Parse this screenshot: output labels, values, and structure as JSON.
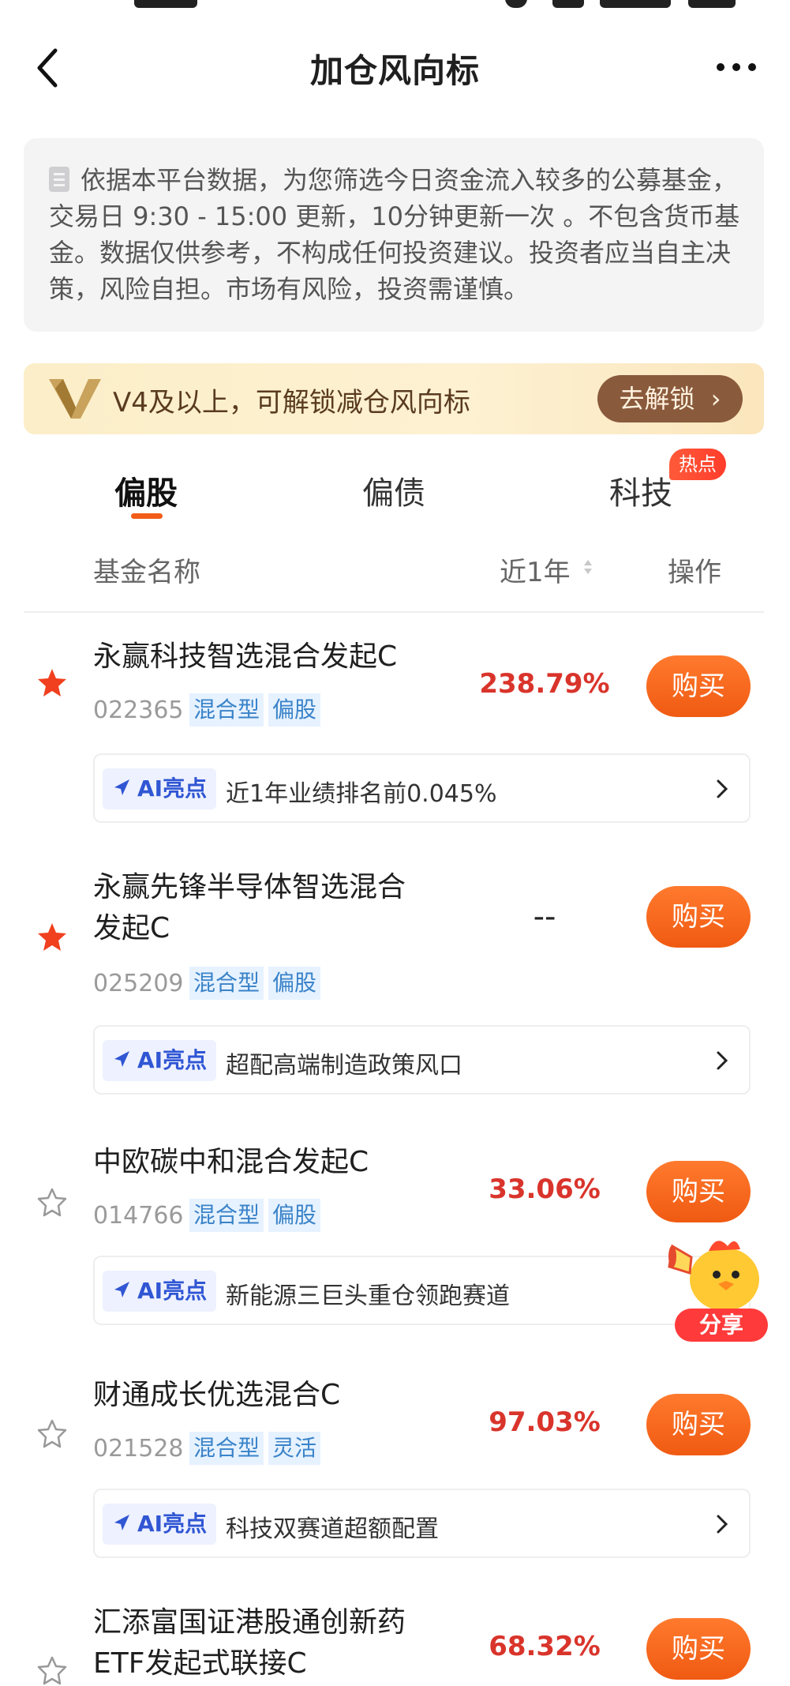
{
  "header": {
    "title": "加仓风向标"
  },
  "notice": {
    "text": "依据本平台数据，为您筛选今日资金流入较多的公募基金，交易日 9:30 - 15:00 更新，10分钟更新一次 。不包含货币基金。数据仅供参考，不构成任何投资建议。投资者应当自主决策，风险自担。市场有风险，投资需谨慎。"
  },
  "vip_banner": {
    "text": "V4及以上，可解锁减仓风向标",
    "button": "去解锁"
  },
  "tabs": [
    {
      "label": "偏股"
    },
    {
      "label": "偏债"
    },
    {
      "label": "科技",
      "badge": "热点"
    }
  ],
  "table_header": {
    "name": "基金名称",
    "period": "近1年",
    "action": "操作"
  },
  "funds": [
    {
      "name": "永赢科技智选混合发起C",
      "code": "022365",
      "tags": [
        "混合型",
        "偏股"
      ],
      "return": "238.79%",
      "buy": "购买",
      "ai_label": "AI亮点",
      "ai_text": "近1年业绩排名前0.045%",
      "starred": true
    },
    {
      "name_line1": "永赢先锋半导体智选混合",
      "name_line2": "发起C",
      "code": "025209",
      "tags": [
        "混合型",
        "偏股"
      ],
      "return": "--",
      "buy": "购买",
      "ai_label": "AI亮点",
      "ai_text": "超配高端制造政策风口",
      "starred": true
    },
    {
      "name": "中欧碳中和混合发起C",
      "code": "014766",
      "tags": [
        "混合型",
        "偏股"
      ],
      "return": "33.06%",
      "buy": "购买",
      "ai_label": "AI亮点",
      "ai_text": "新能源三巨头重仓领跑赛道",
      "starred": false
    },
    {
      "name": "财通成长优选混合C",
      "code": "021528",
      "tags": [
        "混合型",
        "灵活"
      ],
      "return": "97.03%",
      "buy": "购买",
      "ai_label": "AI亮点",
      "ai_text": "科技双赛道超额配置",
      "starred": false
    },
    {
      "name_line1": "汇添富国证港股通创新药",
      "name_line2": "ETF发起式联接C",
      "return": "68.32%",
      "buy": "购买",
      "starred": false
    }
  ],
  "share": {
    "label": "分享"
  },
  "colors": {
    "accent": "#f25c19",
    "return_red": "#d9342b",
    "tag_blue": "#3a83c9",
    "star_active": "#f0401f"
  }
}
